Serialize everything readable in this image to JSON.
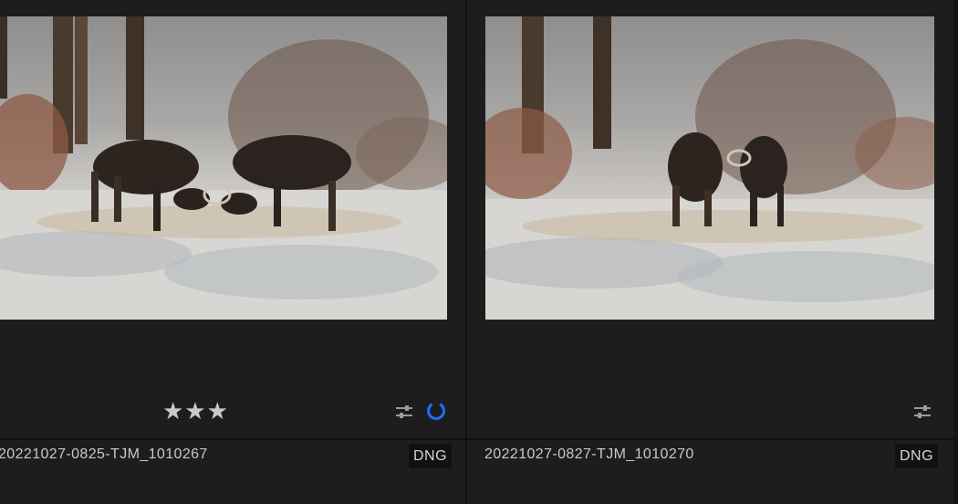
{
  "photos": [
    {
      "filename": "20221027-0825-TJM_1010267",
      "format_badge": "DNG",
      "rating": "★★★",
      "rating_value": 3,
      "has_edits_icon": "adjustments-sliders-icon",
      "status_icon": "sync-progress-icon",
      "status_color": "#1e6fff"
    },
    {
      "filename": "20221027-0827-TJM_1010270",
      "format_badge": "DNG",
      "rating": "",
      "rating_value": 0,
      "has_edits_icon": "adjustments-sliders-icon"
    }
  ]
}
